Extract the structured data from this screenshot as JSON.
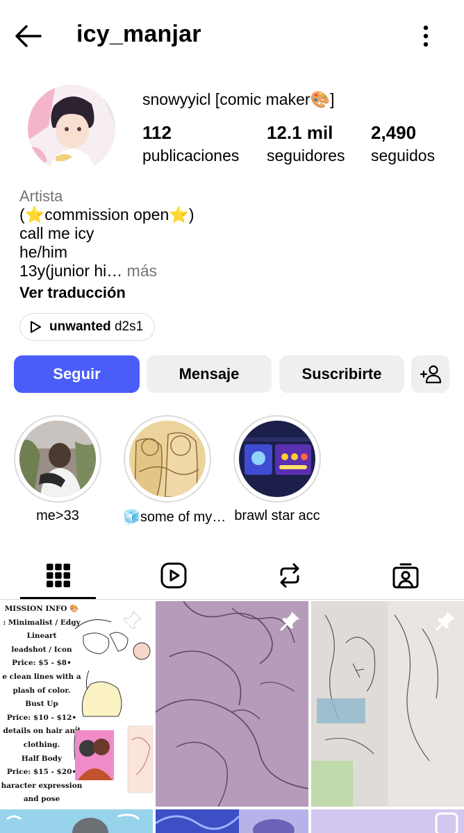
{
  "header": {
    "username": "icy_manjar",
    "back_icon": "arrow-left-icon",
    "more_icon": "more-vertical-icon"
  },
  "profile": {
    "display_name": "snowyyicl [comic maker🎨]",
    "stats": [
      {
        "value": "112",
        "label": "publicaciones"
      },
      {
        "value": "12.1 mil",
        "label": "seguidores"
      },
      {
        "value": "2,490",
        "label": "seguidos"
      }
    ]
  },
  "bio": {
    "category": "Artista",
    "lines": [
      "(⭐commission open⭐)",
      "call me icy",
      "he/him"
    ],
    "truncated_line": "13y(junior hi…",
    "more_label": " más",
    "translate_label": "Ver traducción"
  },
  "audio": {
    "title": "unwanted",
    "artist": " d2s1",
    "icon": "play-outline-icon"
  },
  "actions": {
    "follow": "Seguir",
    "message": "Mensaje",
    "subscribe": "Suscribirte",
    "add_user_icon": "person-add-icon"
  },
  "highlights": [
    {
      "label": "me>33"
    },
    {
      "label": "🧊some of my…"
    },
    {
      "label": "brawl star acc"
    }
  ],
  "tabs": [
    {
      "name": "posts",
      "icon": "grid-icon",
      "active": true
    },
    {
      "name": "reels",
      "icon": "reels-icon",
      "active": false
    },
    {
      "name": "reposts",
      "icon": "repost-icon",
      "active": false
    },
    {
      "name": "tagged",
      "icon": "tagged-icon",
      "active": false
    }
  ],
  "posts": {
    "commission_sheet": {
      "title": "MISSION INFO 🎨",
      "lines": [
        ": Minimalist / Edgy",
        "Lineart",
        "leadshot / Icon",
        "Price: $5 - $8•",
        "e clean lines with a",
        "plash of color.",
        "Bust Up",
        "Price: $10 - $12•",
        "details on hair and",
        "clothing.",
        "Half Body",
        "Price: $15 - $20•",
        "haracter expression",
        "and pose"
      ]
    }
  },
  "colors": {
    "accent": "#4a5df9",
    "button_gray": "#efeff2",
    "muted_text": "#737373",
    "border": "#dbdbdb"
  }
}
